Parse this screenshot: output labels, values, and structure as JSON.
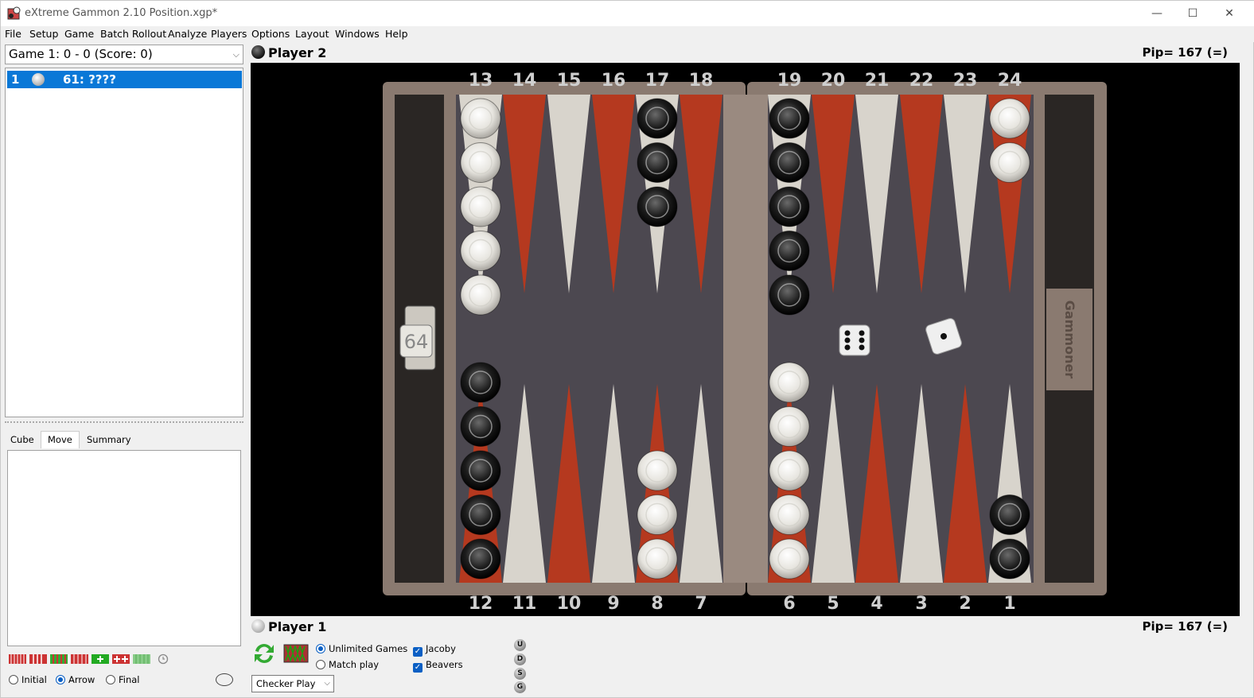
{
  "window": {
    "title": "eXtreme Gammon 2.10 Position.xgp*",
    "minimize": "—",
    "maximize": "☐",
    "close": "✕"
  },
  "menu": [
    "File",
    "Setup",
    "Game",
    "Batch Rollout",
    "Analyze",
    "Players",
    "Options",
    "Layout",
    "Windows",
    "Help"
  ],
  "game_select": {
    "value": "Game 1: 0 - 0 (Score: 0)"
  },
  "move_list": {
    "rows": [
      {
        "num": "1",
        "text": "61: ????"
      }
    ]
  },
  "tabs": [
    "Cube",
    "Move",
    "Summary"
  ],
  "active_tab": "Move",
  "view_radios": [
    {
      "label": "Initial",
      "checked": false
    },
    {
      "label": "Arrow",
      "checked": true
    },
    {
      "label": "Final",
      "checked": false
    }
  ],
  "player2": {
    "name": "Player 2",
    "pip": "Pip= 167 (=)",
    "checker_color": "black"
  },
  "player1": {
    "name": "Player 1",
    "pip": "Pip= 167 (=)",
    "checker_color": "white"
  },
  "board": {
    "top_labels": [
      "13",
      "14",
      "15",
      "16",
      "17",
      "18",
      "19",
      "20",
      "21",
      "22",
      "23",
      "24"
    ],
    "bottom_labels": [
      "12",
      "11",
      "10",
      "9",
      "8",
      "7",
      "6",
      "5",
      "4",
      "3",
      "2",
      "1"
    ],
    "cube_value": "64",
    "cube_brand": "Gammoner",
    "side_label": "Gammoner",
    "dice": [
      6,
      1
    ],
    "points": {
      "13": {
        "color": "white",
        "count": 5
      },
      "17": {
        "color": "black",
        "count": 3
      },
      "19": {
        "color": "black",
        "count": 5
      },
      "24": {
        "color": "white",
        "count": 2
      },
      "12": {
        "color": "black",
        "count": 5
      },
      "8": {
        "color": "white",
        "count": 3
      },
      "6": {
        "color": "white",
        "count": 5
      },
      "1": {
        "color": "black",
        "count": 2
      }
    },
    "colors": {
      "red": "#b5391f",
      "cream": "#d8d4cc",
      "felt": "#4c4850",
      "frame": "#8a7a70",
      "tray": "#2a2624"
    }
  },
  "game_type": [
    {
      "label": "Unlimited Games",
      "checked": true
    },
    {
      "label": "Match play",
      "checked": false
    }
  ],
  "options": [
    {
      "label": "Jacoby",
      "checked": true
    },
    {
      "label": "Beavers",
      "checked": true
    }
  ],
  "play_mode": "Checker Play",
  "udsg": [
    "U",
    "D",
    "S",
    "G"
  ]
}
